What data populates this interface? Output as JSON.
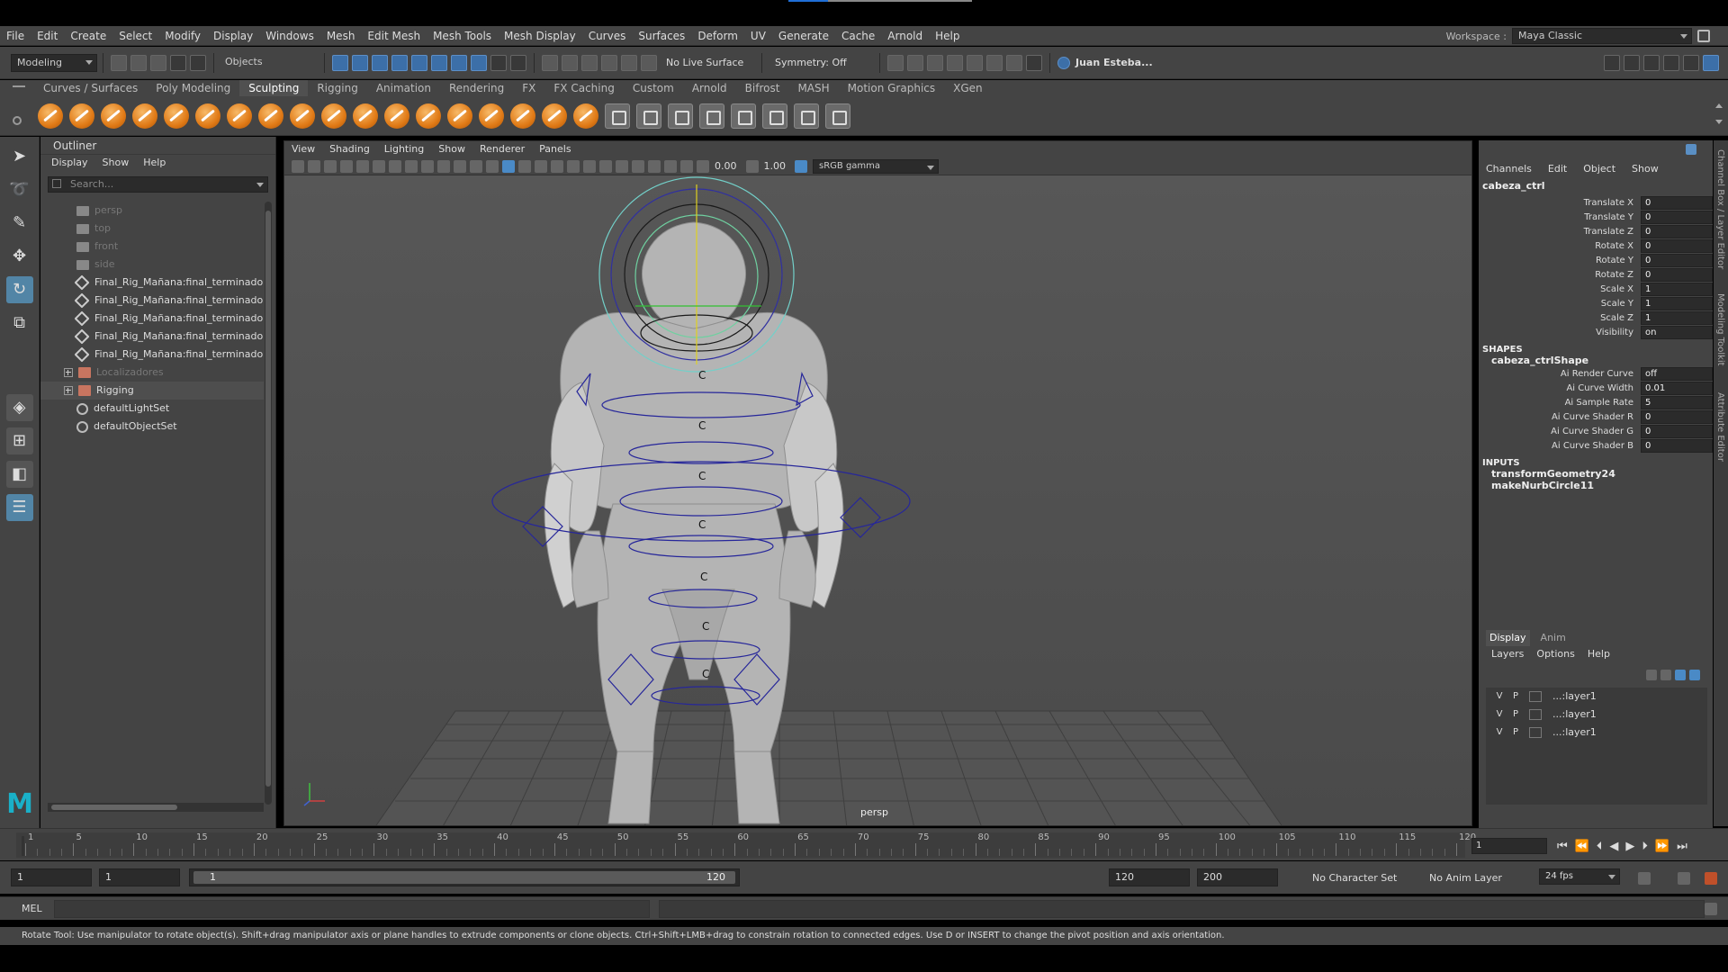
{
  "menubar": {
    "items": [
      "File",
      "Edit",
      "Create",
      "Select",
      "Modify",
      "Display",
      "Windows",
      "Mesh",
      "Edit Mesh",
      "Mesh Tools",
      "Mesh Display",
      "Curves",
      "Surfaces",
      "Deform",
      "UV",
      "Generate",
      "Cache",
      "Arnold",
      "Help"
    ],
    "workspace_label": "Workspace :",
    "workspace_value": "Maya Classic"
  },
  "statusline": {
    "mode": "Modeling",
    "select_mode": "Objects",
    "live_surface": "No Live Surface",
    "symmetry": "Symmetry: Off",
    "user": "Juan Esteba..."
  },
  "shelf": {
    "tabs": [
      "Curves / Surfaces",
      "Poly Modeling",
      "Sculpting",
      "Rigging",
      "Animation",
      "Rendering",
      "FX",
      "FX Caching",
      "Custom",
      "Arnold",
      "Bifrost",
      "MASH",
      "Motion Graphics",
      "XGen"
    ],
    "active_tab": "Sculpting"
  },
  "outliner": {
    "title": "Outliner",
    "menus": [
      "Display",
      "Show",
      "Help"
    ],
    "search_placeholder": "Search...",
    "items": [
      {
        "label": "persp",
        "type": "camera",
        "dim": true
      },
      {
        "label": "top",
        "type": "camera",
        "dim": true
      },
      {
        "label": "front",
        "type": "camera",
        "dim": true
      },
      {
        "label": "side",
        "type": "camera",
        "dim": true
      },
      {
        "label": "Final_Rig_Mañana:final_terminado:Sl",
        "type": "mesh",
        "dim": false
      },
      {
        "label": "Final_Rig_Mañana:final_terminado:Sl",
        "type": "mesh",
        "dim": false
      },
      {
        "label": "Final_Rig_Mañana:final_terminado:Sl",
        "type": "mesh",
        "dim": false
      },
      {
        "label": "Final_Rig_Mañana:final_terminado:Sl",
        "type": "mesh",
        "dim": false
      },
      {
        "label": "Final_Rig_Mañana:final_terminado:Sl",
        "type": "mesh",
        "dim": false
      },
      {
        "label": "Localizadores",
        "type": "group",
        "dim": true
      },
      {
        "label": "Rigging",
        "type": "group",
        "dim": false
      },
      {
        "label": "defaultLightSet",
        "type": "set",
        "dim": false
      },
      {
        "label": "defaultObjectSet",
        "type": "set",
        "dim": false
      }
    ]
  },
  "viewport": {
    "menus": [
      "View",
      "Shading",
      "Lighting",
      "Show",
      "Renderer",
      "Panels"
    ],
    "near_value": "0.00",
    "far_value": "1.00",
    "color_space": "sRGB gamma",
    "camera_label": "persp",
    "control_label": "C"
  },
  "channelbox": {
    "menus": [
      "Channels",
      "Edit",
      "Object",
      "Show"
    ],
    "object": "cabeza_ctrl",
    "attributes": [
      {
        "name": "Translate X",
        "value": "0"
      },
      {
        "name": "Translate Y",
        "value": "0"
      },
      {
        "name": "Translate Z",
        "value": "0"
      },
      {
        "name": "Rotate X",
        "value": "0"
      },
      {
        "name": "Rotate Y",
        "value": "0"
      },
      {
        "name": "Rotate Z",
        "value": "0"
      },
      {
        "name": "Scale X",
        "value": "1"
      },
      {
        "name": "Scale Y",
        "value": "1"
      },
      {
        "name": "Scale Z",
        "value": "1"
      },
      {
        "name": "Visibility",
        "value": "on"
      }
    ],
    "shapes_header": "SHAPES",
    "shape_name": "cabeza_ctrlShape",
    "shape_attributes": [
      {
        "name": "Ai Render Curve",
        "value": "off"
      },
      {
        "name": "Ai Curve Width",
        "value": "0.01"
      },
      {
        "name": "Ai Sample Rate",
        "value": "5"
      },
      {
        "name": "Ai Curve Shader R",
        "value": "0"
      },
      {
        "name": "Ai Curve Shader G",
        "value": "0"
      },
      {
        "name": "Ai Curve Shader B",
        "value": "0"
      }
    ],
    "inputs_header": "INPUTS",
    "inputs": [
      "transformGeometry24",
      "makeNurbCircle11"
    ],
    "side_tabs": [
      "Channel Box / Layer Editor",
      "Modeling Toolkit",
      "Attribute Editor"
    ]
  },
  "layer_editor": {
    "tabs": [
      "Display",
      "Anim"
    ],
    "menus": [
      "Layers",
      "Options",
      "Help"
    ],
    "layers": [
      {
        "v": "V",
        "p": "P",
        "name": "...:layer1"
      },
      {
        "v": "V",
        "p": "P",
        "name": "...:layer1"
      },
      {
        "v": "V",
        "p": "P",
        "name": "...:layer1"
      }
    ]
  },
  "timeslider": {
    "ticks": [
      "1",
      "5",
      "10",
      "15",
      "20",
      "25",
      "30",
      "35",
      "40",
      "45",
      "50",
      "55",
      "60",
      "65",
      "70",
      "75",
      "80",
      "85",
      "90",
      "95",
      "100",
      "105",
      "110",
      "115",
      "120"
    ],
    "current_frame": "1"
  },
  "range": {
    "start": "1",
    "playback_start": "1",
    "bar_start": "1",
    "bar_end": "120",
    "playback_end": "120",
    "end": "200",
    "character_set": "No Character Set",
    "anim_layer": "No Anim Layer",
    "fps": "24 fps"
  },
  "cmdline": {
    "label": "MEL"
  },
  "helpline": {
    "text": "Rotate Tool: Use manipulator to rotate object(s). Shift+drag manipulator axis or plane handles to extrude components or clone objects. Ctrl+Shift+LMB+drag to constrain rotation to connected edges. Use D or INSERT to change the pivot position and axis orientation."
  }
}
